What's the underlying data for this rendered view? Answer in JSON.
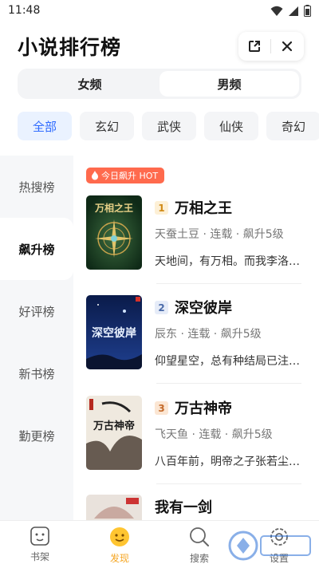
{
  "status": {
    "time": "11:48"
  },
  "header": {
    "title": "小说排行榜"
  },
  "gender_tabs": [
    {
      "label": "女频",
      "active": false
    },
    {
      "label": "男频",
      "active": true
    }
  ],
  "categories": [
    {
      "label": "全部",
      "active": true
    },
    {
      "label": "玄幻",
      "active": false
    },
    {
      "label": "武侠",
      "active": false
    },
    {
      "label": "仙侠",
      "active": false
    },
    {
      "label": "奇幻",
      "active": false
    }
  ],
  "left_nav": [
    {
      "label": "热搜榜",
      "active": false
    },
    {
      "label": "飙升榜",
      "active": true
    },
    {
      "label": "好评榜",
      "active": false
    },
    {
      "label": "新书榜",
      "active": false
    },
    {
      "label": "勤更榜",
      "active": false
    }
  ],
  "badge": {
    "label": "今日飙升 HOT"
  },
  "books": [
    {
      "rank": "1",
      "title": "万相之王",
      "meta": "天蚕土豆 · 连载 · 飙升5级",
      "desc": "天地间，有万相。而我李洛，终将成为这万相之王。"
    },
    {
      "rank": "2",
      "title": "深空彼岸",
      "meta": "辰东 · 连载 · 飙升5级",
      "desc": "仰望星空，总有种结局已注定的感觉。"
    },
    {
      "rank": "3",
      "title": "万古神帝",
      "meta": "飞天鱼 · 连载 · 飙升5级",
      "desc": "八百年前，明帝之子张若尘，被他的未婚妻杀死。"
    },
    {
      "rank": "",
      "title": "我有一剑",
      "meta": "",
      "desc": ""
    }
  ],
  "cover_texts": [
    "万相之王",
    "深空彼岸",
    "万古神帝"
  ],
  "tabs": [
    {
      "label": "书架",
      "active": false
    },
    {
      "label": "发现",
      "active": true
    },
    {
      "label": "搜索",
      "active": false
    },
    {
      "label": "设置",
      "active": false
    }
  ],
  "colors": {
    "accent_blue": "#2f6bff",
    "accent_orange": "#f5a623",
    "hot_red": "#ff6a4d"
  }
}
